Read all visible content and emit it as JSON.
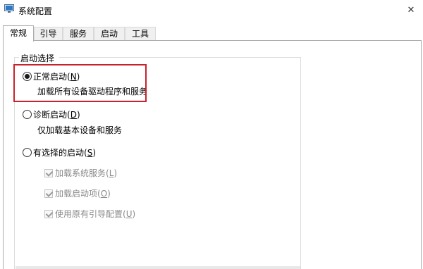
{
  "window": {
    "title": "系统配置",
    "icon": "system-config-icon",
    "close_glyph": "✕"
  },
  "tabs": [
    {
      "label": "常规",
      "active": true
    },
    {
      "label": "引导",
      "active": false
    },
    {
      "label": "服务",
      "active": false
    },
    {
      "label": "启动",
      "active": false
    },
    {
      "label": "工具",
      "active": false
    }
  ],
  "startup_group": {
    "legend": "启动选择",
    "options": [
      {
        "label": "正常启动(",
        "accel": "N",
        "tail": ")",
        "description": "加载所有设备驱动程序和服务",
        "checked": true
      },
      {
        "label": "诊断启动(",
        "accel": "D",
        "tail": ")",
        "description": "仅加载基本设备和服务",
        "checked": false
      },
      {
        "label": "有选择的启动(",
        "accel": "S",
        "tail": ")",
        "checked": false
      }
    ],
    "selective_items": [
      {
        "label": "加载系统服务(",
        "accel": "L",
        "tail": ")",
        "checked": true,
        "disabled": true
      },
      {
        "label": "加载启动项(",
        "accel": "O",
        "tail": ")",
        "checked": true,
        "disabled": true
      },
      {
        "label": "使用原有引导配置(",
        "accel": "U",
        "tail": ")",
        "checked": true,
        "disabled": true
      }
    ]
  },
  "colors": {
    "highlight_border": "#c8232c",
    "disabled_text": "#8a8a8a"
  }
}
